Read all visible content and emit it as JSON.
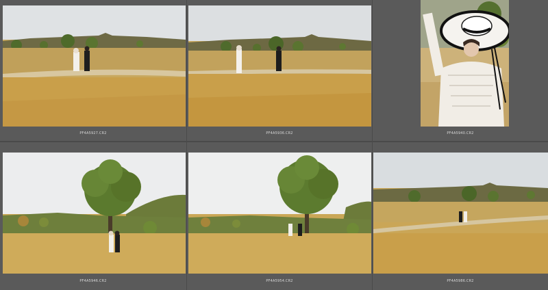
{
  "thumbnails": [
    {
      "filename": "PF4A5927.CR2",
      "scene": "field-couple-walking"
    },
    {
      "filename": "PF4A5936.CR2",
      "scene": "field-couple-apart"
    },
    {
      "filename": "PF4A5940.CR2",
      "scene": "portrait-hat"
    },
    {
      "filename": "PF4A5946.CR2",
      "scene": "tree-couple-close"
    },
    {
      "filename": "PF4A5954.CR2",
      "scene": "tree-couple-far"
    },
    {
      "filename": "PF4A5986.CR2",
      "scene": "field-path-far"
    }
  ],
  "colors": {
    "background": "#595959",
    "label": "#d9d9d9",
    "sky": "#d7dce0",
    "grass": "#c9a654",
    "tree": "#5b7a2e"
  }
}
